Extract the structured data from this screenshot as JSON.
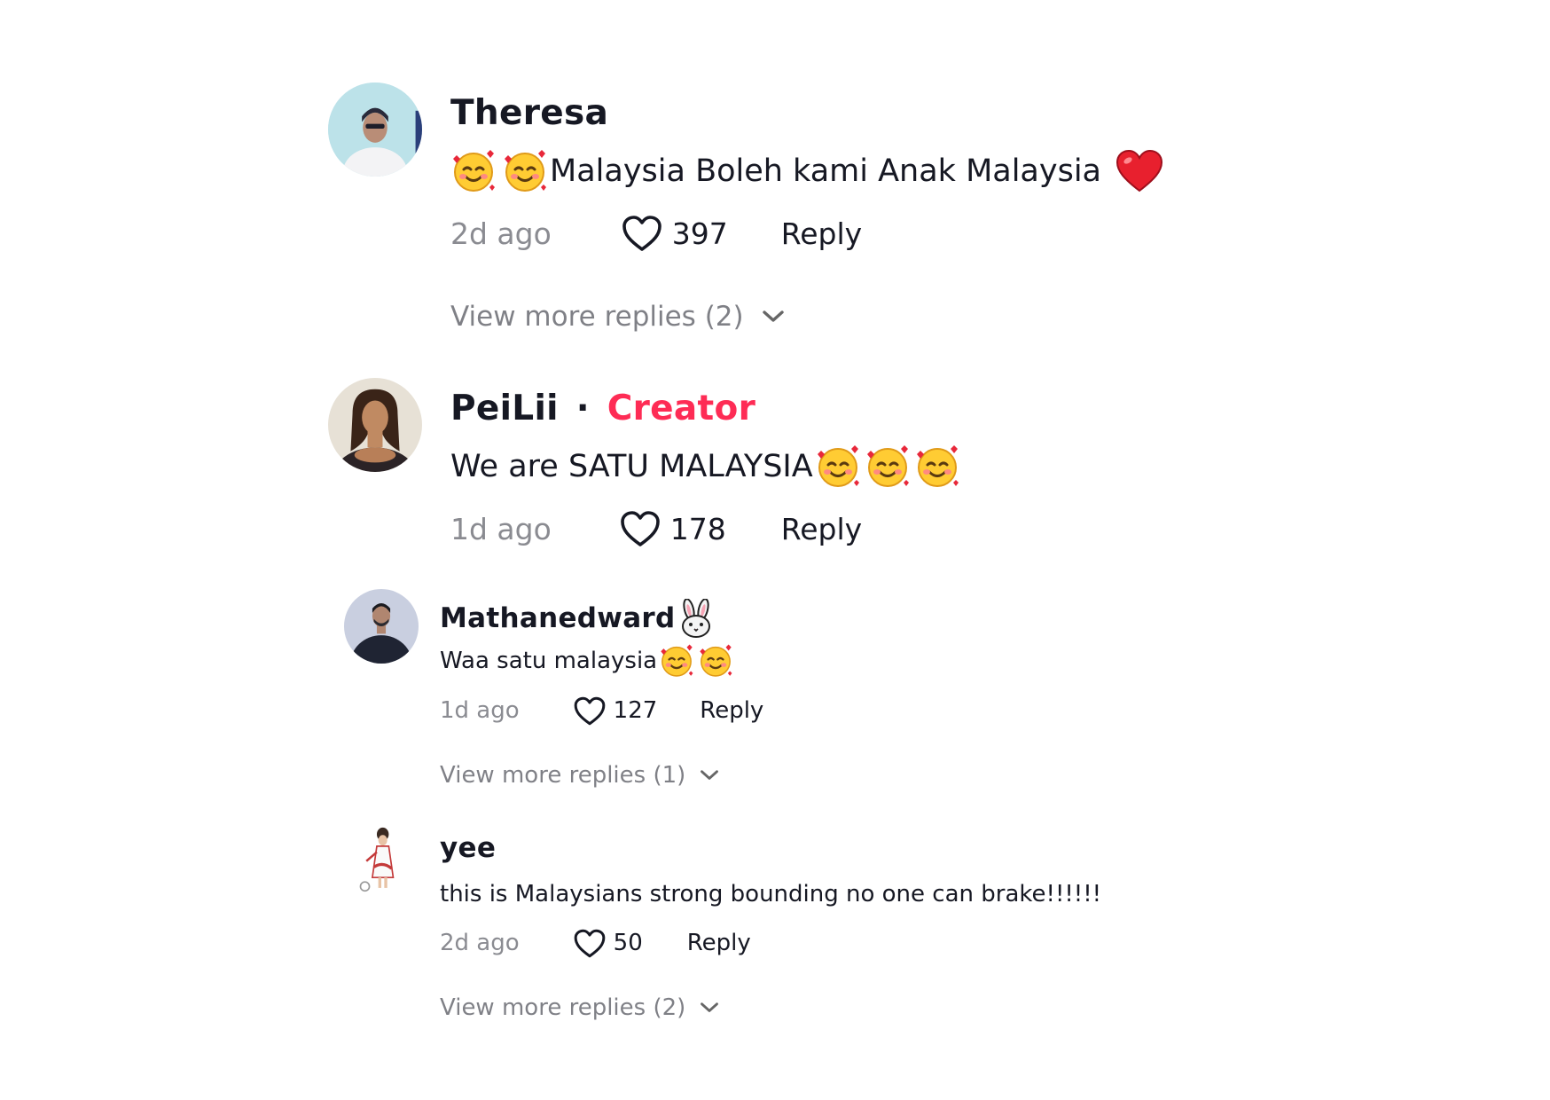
{
  "accent_color": "#fe2c55",
  "comments": [
    {
      "username": "Theresa",
      "badge": "",
      "text_emojis_before": [
        "smiling-face-with-hearts",
        "smiling-face-with-hearts"
      ],
      "text": "Malaysia Boleh kami Anak Malaysia",
      "text_emojis_after": [
        "red-heart"
      ],
      "time": "2d ago",
      "likes": "397",
      "reply_label": "Reply",
      "view_more": "View more replies (2)"
    },
    {
      "username": "PeiLii",
      "badge_separator": "·",
      "badge": "Creator",
      "text": "We are SATU MALAYSIA",
      "text_emojis_after": [
        "smiling-face-with-hearts",
        "smiling-face-with-hearts",
        "smiling-face-with-hearts"
      ],
      "time": "1d ago",
      "likes": "178",
      "reply_label": "Reply"
    },
    {
      "username": "Mathanedward",
      "username_emoji": "rabbit-face",
      "text": "Waa satu malaysia",
      "text_emojis_after": [
        "smiling-face-with-hearts",
        "smiling-face-with-hearts"
      ],
      "time": "1d ago",
      "likes": "127",
      "reply_label": "Reply",
      "view_more": "View more replies (1)"
    },
    {
      "username": "yee",
      "text": "this is Malaysians strong bounding no one can brake!!!!!!",
      "time": "2d ago",
      "likes": "50",
      "reply_label": "Reply",
      "view_more": "View more replies (2)"
    }
  ]
}
